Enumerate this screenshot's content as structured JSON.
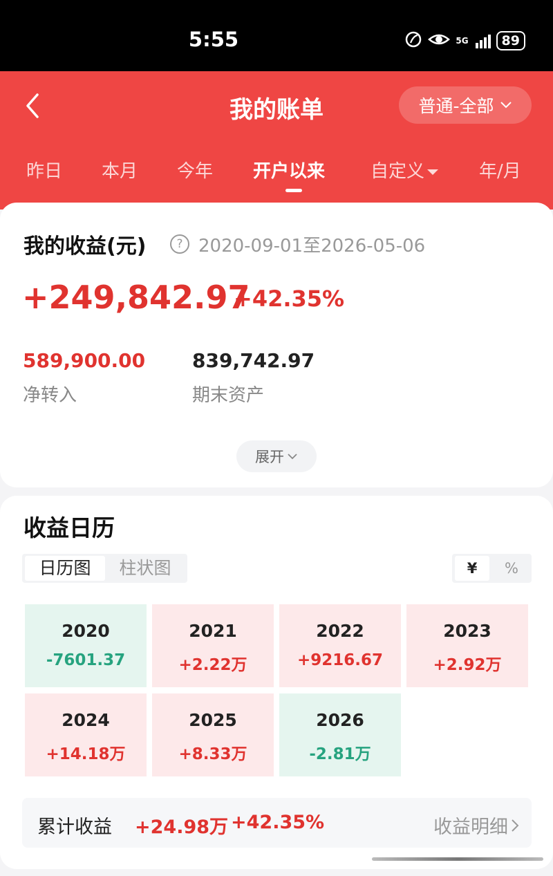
{
  "status": {
    "time": "5:55",
    "network": "5G",
    "battery": "89"
  },
  "nav": {
    "title": "我的账单",
    "filter_label": "普通-全部"
  },
  "tabs": [
    "昨日",
    "本月",
    "今年",
    "开户以来",
    "自定义",
    "年/月"
  ],
  "summary": {
    "label": "我的收益(元)",
    "help": "?",
    "date_range": "2020-09-01至2026-05-06",
    "profit": "+249,842.97",
    "profit_pct": "+42.35%",
    "net_transfer": "589,900.00",
    "net_transfer_label": "净转入",
    "end_assets": "839,742.97",
    "end_assets_label": "期末资产",
    "expand_label": "展开"
  },
  "calendar": {
    "title": "收益日历",
    "views": [
      "日历图",
      "柱状图"
    ],
    "units": [
      "¥",
      "%"
    ],
    "years": [
      {
        "year": "2020",
        "value": "-7601.37",
        "trend": "down"
      },
      {
        "year": "2021",
        "value": "+2.22万",
        "trend": "up"
      },
      {
        "year": "2022",
        "value": "+9216.67",
        "trend": "up"
      },
      {
        "year": "2023",
        "value": "+2.92万",
        "trend": "up"
      },
      {
        "year": "2024",
        "value": "+14.18万",
        "trend": "up"
      },
      {
        "year": "2025",
        "value": "+8.33万",
        "trend": "up"
      },
      {
        "year": "2026",
        "value": "-2.81万",
        "trend": "down"
      }
    ],
    "total": {
      "label": "累计收益",
      "amount": "+24.98万",
      "pct": "+42.35%",
      "detail_link": "收益明细"
    }
  },
  "colors": {
    "brand_red": "#ef4644",
    "profit_red": "#e0332f",
    "loss_green": "#26a37f"
  }
}
